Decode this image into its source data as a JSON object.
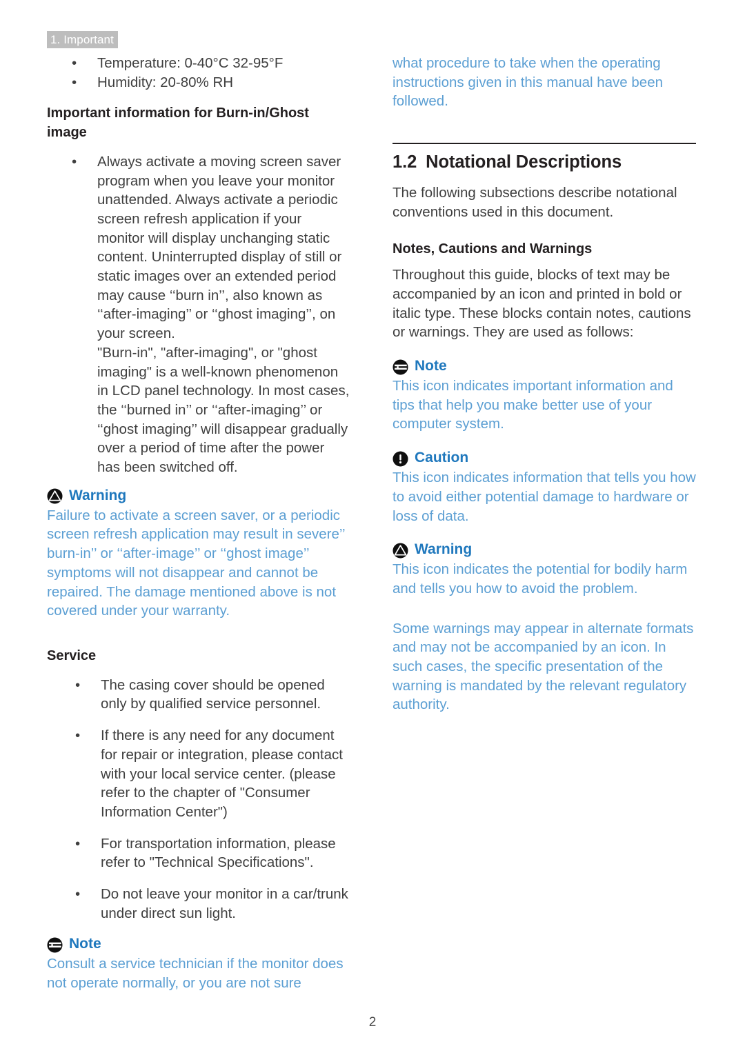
{
  "document": {
    "running_header": "1. Important",
    "page_number": "2"
  },
  "colors": {
    "header_badge_bg": "#bdbdbd",
    "header_badge_text": "#ffffff",
    "body_text": "#3f3f3f",
    "heading_text": "#231f20",
    "callout_title_blue": "#1f78bd",
    "callout_body_blue": "#5c9fd3",
    "rule": "#231f20"
  },
  "left_column": {
    "env_bullets": [
      "Temperature: 0-40°C 32-95°F",
      "Humidity: 20-80% RH"
    ],
    "burn_in_heading": "Important information for Burn-in/Ghost image",
    "burn_in_bullet": "Always activate a moving screen saver program when you leave your monitor unattended. Always activate a periodic screen refresh application if your monitor will display unchanging static content. Uninterrupted display of still or static images over an extended period may cause ‘‘burn in’’, also known as ‘‘after-imaging’’ or ‘‘ghost imaging’’, on your screen.",
    "burn_in_paragraph": "\"Burn-in\", \"after-imaging\", or \"ghost imaging\" is a well-known phenomenon in LCD panel technology. In most cases, the ‘‘burned in’’ or ‘‘after-imaging’’ or ‘‘ghost imaging’’ will disappear gradually over a period of time after the power has been switched off.",
    "warning_callout": {
      "icon": "warning-triangle-icon",
      "title": "Warning",
      "body": "Failure to activate a screen saver, or a periodic screen refresh application may result in severe’’ burn-in’’ or ‘‘after-image’’ or ‘‘ghost image’’ symptoms will not disappear and cannot be repaired. The damage mentioned above is not covered under your warranty."
    },
    "service_heading": "Service",
    "service_bullets": [
      "The casing cover should be opened only by qualified service personnel.",
      "If there is any need for any document for repair or integration, please contact with your local service center. (please refer to the chapter of \"Consumer Information Center\")",
      "For transportation information, please refer to \"Technical Specifications\".",
      "Do not leave your monitor in a car/trunk under direct sun light."
    ],
    "note_callout": {
      "icon": "note-lines-icon",
      "title": "Note",
      "body": "Consult a service technician if the monitor does not operate normally, or you are not sure"
    }
  },
  "right_column": {
    "continued_note_body": "what procedure to take when the operating instructions given in this manual have been followed.",
    "section": {
      "number": "1.2",
      "title": "Notational Descriptions"
    },
    "intro_paragraph": "The following subsections describe notational conventions used in this document.",
    "subsection_heading": "Notes, Cautions and Warnings",
    "subsection_paragraph": "Throughout this guide, blocks of text may be accompanied by an icon and printed in bold or italic type. These blocks contain notes, cautions or warnings. They are used as follows:",
    "note_callout": {
      "icon": "note-lines-icon",
      "title": "Note",
      "body": "This icon indicates important information and tips that help you make better use of your computer system."
    },
    "caution_callout": {
      "icon": "caution-exclamation-icon",
      "title": "Caution",
      "body": "This icon indicates information that tells you how to avoid either potential damage to hardware or loss of data."
    },
    "warning_callout": {
      "icon": "warning-triangle-icon",
      "title": "Warning",
      "body": "This icon indicates the potential for bodily harm and tells you how to avoid the problem."
    },
    "closing_paragraph": "Some warnings may appear in alternate formats and may not be accompanied by an icon. In such cases, the specific presentation of the warning is mandated by the relevant regulatory authority."
  }
}
